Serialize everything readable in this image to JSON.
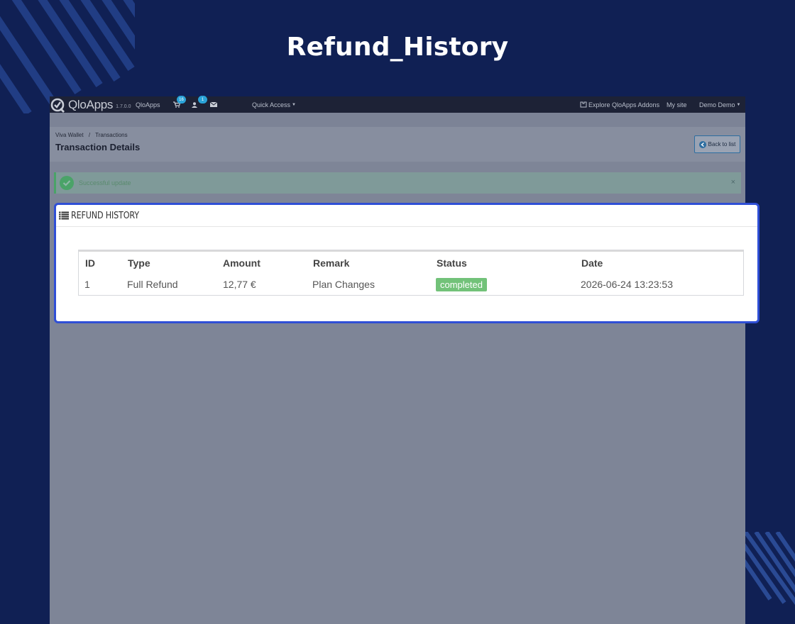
{
  "page": {
    "heading": "Refund_History"
  },
  "topbar": {
    "logo_text": "QloApps",
    "version": "1.7.0.0",
    "shop_name": "QloApps",
    "cart_badge": "16",
    "customer_badge": "1",
    "quick_access": "Quick Access",
    "explore_addons": "Explore QloApps Addons",
    "my_site": "My site",
    "user": "Demo Demo"
  },
  "breadcrumb": {
    "items": [
      "Viva Wallet",
      "Transactions"
    ]
  },
  "header": {
    "title": "Transaction Details",
    "back_button": "Back to list"
  },
  "alert": {
    "text": "Successful update",
    "close": "×"
  },
  "refund_history": {
    "title": "REFUND HISTORY",
    "columns": [
      "ID",
      "Type",
      "Amount",
      "Remark",
      "Status",
      "Date"
    ],
    "rows": [
      {
        "id": "1",
        "type": "Full Refund",
        "amount": "12,77 €",
        "remark": "Plan Changes",
        "status": "completed",
        "date": "2026-06-24 13:23:53"
      }
    ]
  },
  "colors": {
    "background": "#102054",
    "highlight_border": "#2f4fd6",
    "status_completed": "#72c279",
    "badge": "#2aa3d8"
  },
  "icons": {
    "logo": "qloapps-logo-icon",
    "cart": "cart-icon",
    "customer": "user-icon",
    "messages": "envelope-icon",
    "addons": "puzzle-icon",
    "back": "arrow-left-circle-icon",
    "alert": "check-circle-icon",
    "panel": "list-icon"
  }
}
